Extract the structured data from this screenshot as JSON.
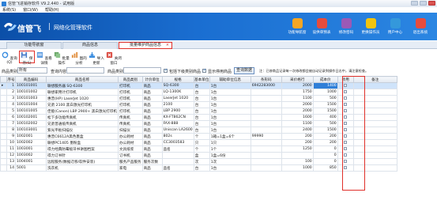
{
  "window": {
    "title": "信管飞进销存软件 V9.2.440 - 试用版"
  },
  "menu": [
    "系统(S)",
    "窗口(W)",
    "帮助(H)"
  ],
  "banner": {
    "brand": "信管飞",
    "slogan": "网络化管理软件",
    "buttons": [
      {
        "label": "功能导航窗",
        "color": "#f5a623"
      },
      {
        "label": "设供单预表",
        "color": "#e74c3c"
      },
      {
        "label": "修改密码",
        "color": "#9b59b6"
      },
      {
        "label": "更换操作员",
        "color": "#f1c40f"
      },
      {
        "label": "用户中心",
        "color": "#3498db"
      },
      {
        "label": "退出系统",
        "color": "#e74c3c"
      }
    ]
  },
  "tabs": [
    {
      "label": "功能导航窗"
    },
    {
      "label": "商品信息"
    },
    {
      "label": "批量维护商品信息",
      "close": "×"
    }
  ],
  "toolbar": [
    {
      "label": "查询(Q)",
      "icon": "refresh-icon",
      "color": "#3a8de0"
    },
    {
      "label": "保存(S)",
      "icon": "save-icon",
      "color": "#4a7cc9"
    },
    {
      "label": "查看详情",
      "icon": "details-icon",
      "color": "#5c9be0"
    },
    {
      "label": "批量操作",
      "icon": "batch-icon",
      "color": "#6ca86a"
    },
    {
      "label": "图的分析",
      "icon": "chart-icon",
      "color": "#e08c3a"
    },
    {
      "label": "导入更新",
      "icon": "import-icon",
      "color": "#3a8de0"
    },
    {
      "label": "关闭窗口",
      "icon": "close-window-icon",
      "color": "#d9463c"
    }
  ],
  "filter": {
    "type_label": "商品类别",
    "type_value": "所有",
    "content_label": "查询内容",
    "content_value": "",
    "class_label": "商品类别",
    "class_value": "",
    "chk1_label": "包括下级类别商品",
    "chk2_label": "显示停用商品",
    "query_btn": "查询数据",
    "hint": "注：已修商品记录每一次修改都会被自动记录到操作日志中，请注意检查。"
  },
  "grid": {
    "columns": [
      "序号",
      "商品编码",
      "商品名称",
      "商品类别",
      "计价单位",
      "规格",
      "基本单位",
      "辅助单位信息",
      "条形码",
      "采价格行",
      "成本价",
      "停用",
      "备注"
    ],
    "rows": [
      [
        "1",
        "100101001",
        "联想服务器 SQ-6300",
        "打印机",
        "商品",
        "SQ-6300",
        "台",
        "1台",
        "6942283000",
        "2000",
        "1400"
      ],
      [
        "2",
        "100101002",
        "联想家用计打印机",
        "打印机",
        "商品",
        "LQ-1300K",
        "台",
        "1台",
        "",
        "1750",
        "1000"
      ],
      [
        "3",
        "100101003",
        "惠普(HP) LaserJet 1020",
        "打印机",
        "商品",
        "LaserJet 1020",
        "台",
        "1台",
        "",
        "1100",
        "500"
      ],
      [
        "4",
        "100101004",
        "兄弟 2100 黑白激光打印机",
        "打印机",
        "商品",
        "2100",
        "台",
        "1台",
        "",
        "2000",
        "1500"
      ],
      [
        "5",
        "100101005",
        "佳能(Canon) LBP 2900+ 黑白激光打印机",
        "打印机",
        "商品",
        "LBP 2900",
        "台",
        "1台",
        "",
        "2000",
        "1500"
      ],
      [
        "6",
        "100102001",
        "松下多功能传真机",
        "传真机",
        "商品",
        "KX-FT862CN",
        "台",
        "1台",
        "",
        "1600",
        "400"
      ],
      [
        "7",
        "100102002",
        "兄弟普通纸传真机",
        "传真机",
        "商品",
        "FAX-888",
        "台",
        "1台",
        "",
        "1100",
        "500"
      ],
      [
        "8",
        "100103001",
        "紫光平板扫描仪",
        "扫描仪",
        "商品",
        "Uniscan LA2600",
        "台",
        "1台",
        "",
        "2400",
        "1500"
      ],
      [
        "9",
        "1002001",
        "惠普C6612A黑色墨盒",
        "办公耗材",
        "商品",
        "802s",
        "个",
        "1箱=1盒=6个",
        "99990",
        "200",
        "200"
      ],
      [
        "10",
        "1002002",
        "联想PC1405 墨粉盒",
        "办公耗材",
        "商品",
        "CC3003583",
        "只",
        "1只",
        "",
        "200",
        "200"
      ],
      [
        "11",
        "1003001",
        "得力经典防霉极牙书讲图档案",
        "文具纸浆",
        "商品",
        "品名",
        "个",
        "1个",
        "",
        "1250",
        "0"
      ],
      [
        "12",
        "1003002",
        "得力订书针",
        "订书机",
        "商品",
        "",
        "盒",
        "1盒=6份",
        "",
        "",
        "0"
      ],
      [
        "13",
        "1004001",
        "远程服务(数据迁移/软件安装)",
        "服务产品服务",
        "服务次数",
        "",
        "次",
        "1次",
        "",
        "100",
        "0"
      ],
      [
        "14",
        "5001",
        "洗衣机",
        "家电",
        "商品",
        "品名",
        "台",
        "1台",
        "",
        "1000",
        "850"
      ]
    ]
  },
  "colors": {
    "accent": "#1a6ed1",
    "highlight": "#e0302a",
    "selected": "#cfe3fa"
  }
}
